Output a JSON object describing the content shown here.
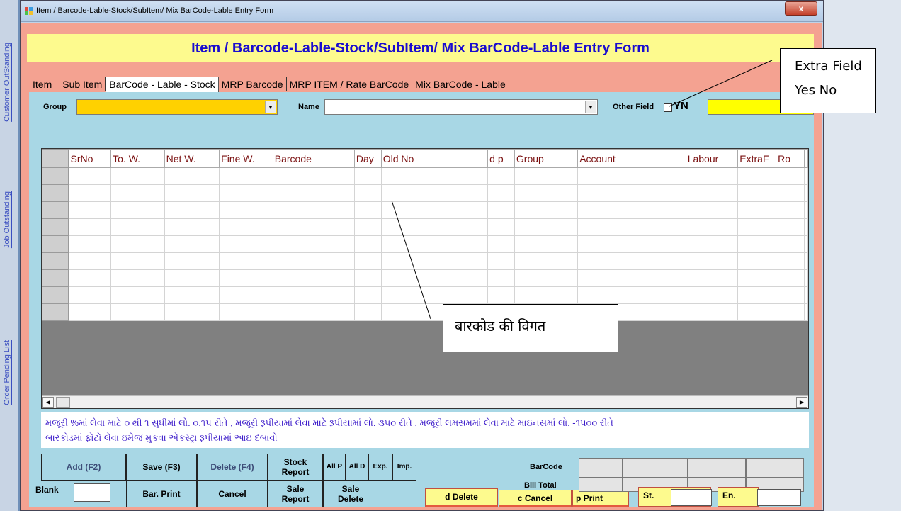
{
  "window": {
    "title": "Item / Barcode-Lable-Stock/SubItem/ Mix BarCode-Lable Entry Form",
    "close": "x"
  },
  "side_links": [
    "Customer OutStanding",
    "Order Pending List",
    "Job Outstanding"
  ],
  "heading": "Item / Barcode-Lable-Stock/SubItem/ Mix BarCode-Lable Entry Form",
  "tabs": [
    "Item",
    "Sub Item",
    "BarCode - Lable - Stock",
    "MRP Barcode",
    "MRP ITEM / Rate BarCode",
    "Mix BarCode - Lable"
  ],
  "filters": {
    "group_label": "Group",
    "name_label": "Name",
    "other_field_label": "Other Field",
    "yn_label": "YN"
  },
  "grid": {
    "columns": [
      "SrNo",
      "To. W.",
      "Net W.",
      "Fine W.",
      "Barcode",
      "Day",
      "Old No",
      "d p",
      "Group",
      "Account",
      "Labour",
      "ExtraF",
      "Ro"
    ],
    "empty_rows": 9
  },
  "note": {
    "line1": "મજૂરી %માં લેવા માટે ૦ થી ૧ સુધીમાં લો. ૦.૧૫ રીતે , મજૂરી રૂપીયામાં લેવા માટે રૂપીયામાં લો. ૩૫૦ રીતે ,  મજૂરી લમસમમાં લેવા માટે માઇનસમાં લો. -૧૫૦૦ રીતે",
    "line2": "બારકોડમાં ફોટો લેવા ઇમેજ  મુકવા એકસ્ટ્રા રૂપીયામાં આઇ દબાવો"
  },
  "buttons": {
    "add": "Add (F2)",
    "save": "Save (F3)",
    "delete": "Delete (F4)",
    "stock_report_1": "Stock",
    "stock_report_2": "Report",
    "all_p": "All P",
    "all_d": "All D",
    "exp": "Exp.",
    "imp": "Imp.",
    "bar_print": "Bar. Print",
    "cancel": "Cancel",
    "sale_report_1": "Sale",
    "sale_report_2": "Report",
    "sale_delete_1": "Sale",
    "sale_delete_2": "Delete",
    "d_delete": "d Delete",
    "c_cancel": "c Cancel",
    "p_print": "p Print"
  },
  "labels": {
    "blank": "Blank",
    "barcode": "BarCode",
    "bill_total": "Bill Total",
    "st": "St.",
    "en": "En."
  },
  "callouts": {
    "extra_field_1": "Extra Field",
    "extra_field_2": "Yes No",
    "barcode_detail": "बारकोड की विगत"
  },
  "colors": {
    "heading_bg": "#fdfa8e",
    "heading_text": "#1a0ccf",
    "frame": "#f4a291",
    "panel": "#a8d7e5",
    "group_field": "#ffd100",
    "column_header_text": "#7a1010",
    "note_text": "#3a19c9"
  }
}
